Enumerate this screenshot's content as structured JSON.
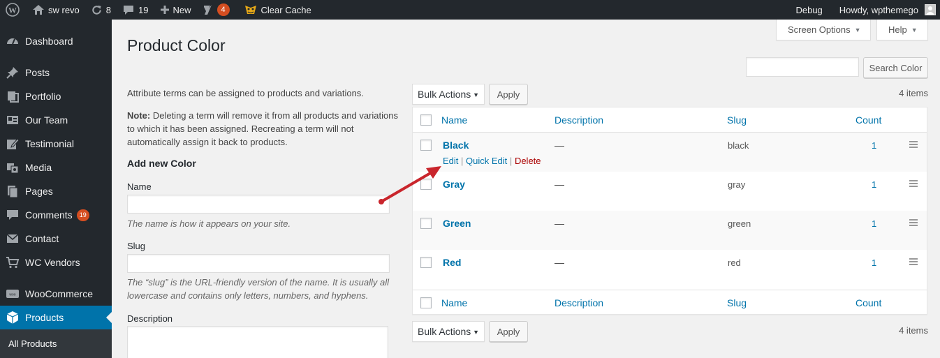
{
  "adminbar": {
    "site_name": "sw revo",
    "updates_count": "8",
    "comments_count": "19",
    "new_label": "New",
    "yoast_badge": "4",
    "clear_cache_label": "Clear Cache",
    "debug_label": "Debug",
    "howdy_label": "Howdy, wpthemego"
  },
  "sidebar": {
    "items": [
      {
        "label": "Dashboard",
        "icon": "dashboard-icon"
      },
      {
        "label": "Posts",
        "icon": "pin-icon"
      },
      {
        "label": "Portfolio",
        "icon": "portfolio-icon"
      },
      {
        "label": "Our Team",
        "icon": "team-icon"
      },
      {
        "label": "Testimonial",
        "icon": "edit-icon"
      },
      {
        "label": "Media",
        "icon": "media-icon"
      },
      {
        "label": "Pages",
        "icon": "pages-icon"
      },
      {
        "label": "Comments",
        "icon": "comment-icon",
        "badge": "19"
      },
      {
        "label": "Contact",
        "icon": "mail-icon"
      },
      {
        "label": "WC Vendors",
        "icon": "cart-icon"
      },
      {
        "label": "WooCommerce",
        "icon": "woo-icon"
      },
      {
        "label": "Products",
        "icon": "box-icon"
      }
    ],
    "submenu_label": "All Products"
  },
  "header": {
    "screen_options_label": "Screen Options",
    "help_label": "Help",
    "page_title": "Product Color"
  },
  "form": {
    "intro": "Attribute terms can be assigned to products and variations.",
    "note_label": "Note:",
    "note_text": " Deleting a term will remove it from all products and variations to which it has been assigned. Recreating a term will not automatically assign it back to products.",
    "add_title": "Add new Color",
    "name_label": "Name",
    "name_hint": "The name is how it appears on your site.",
    "slug_label": "Slug",
    "slug_hint": "The “slug” is the URL-friendly version of the name. It is usually all lowercase and contains only letters, numbers, and hyphens.",
    "description_label": "Description"
  },
  "table": {
    "search_button": "Search Color",
    "bulk_actions": "Bulk Actions",
    "apply_label": "Apply",
    "items_count": "4 items",
    "columns": {
      "name": "Name",
      "description": "Description",
      "slug": "Slug",
      "count": "Count"
    },
    "rows": [
      {
        "name": "Black",
        "description": "—",
        "slug": "black",
        "count": "1"
      },
      {
        "name": "Gray",
        "description": "—",
        "slug": "gray",
        "count": "1"
      },
      {
        "name": "Green",
        "description": "—",
        "slug": "green",
        "count": "1"
      },
      {
        "name": "Red",
        "description": "—",
        "slug": "red",
        "count": "1"
      }
    ],
    "row_actions": {
      "edit": "Edit",
      "quick_edit": "Quick Edit",
      "delete": "Delete",
      "separator": "|"
    }
  },
  "colors": {
    "adminbar_bg": "#23282d",
    "sidebar_current": "#0073aa",
    "link": "#0073aa",
    "delete": "#a00",
    "annotation_arrow": "#c9252c"
  }
}
